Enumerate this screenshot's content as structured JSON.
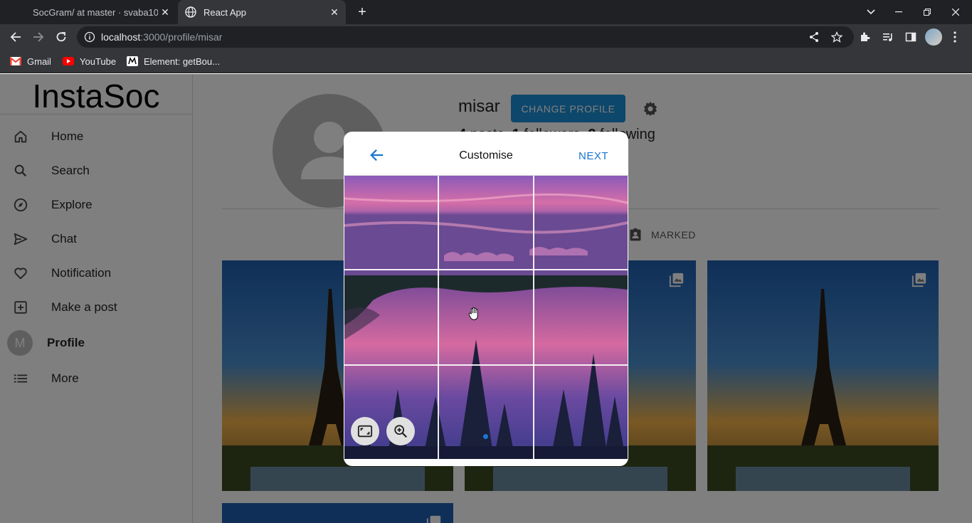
{
  "browser": {
    "tabs": [
      {
        "title": "SocGram/ at master · svaba10",
        "active": false
      },
      {
        "title": "React App",
        "active": true
      }
    ],
    "address": {
      "host": "localhost",
      "path": ":3000/profile/misar"
    },
    "bookmarks": [
      {
        "label": "Gmail",
        "icon": "gmail-icon"
      },
      {
        "label": "YouTube",
        "icon": "youtube-icon"
      },
      {
        "label": "Element: getBou...",
        "icon": "element-icon"
      }
    ]
  },
  "app": {
    "logo": "InstaSoc",
    "nav": [
      {
        "label": "Home",
        "icon": "home-icon"
      },
      {
        "label": "Search",
        "icon": "search-icon"
      },
      {
        "label": "Explore",
        "icon": "compass-icon"
      },
      {
        "label": "Chat",
        "icon": "send-icon"
      },
      {
        "label": "Notification",
        "icon": "heart-icon"
      },
      {
        "label": "Make a post",
        "icon": "add-box-icon"
      },
      {
        "label": "Profile",
        "avatar_letter": "M"
      },
      {
        "label": "More",
        "icon": "list-icon"
      }
    ]
  },
  "profile": {
    "username": "misar",
    "change_button": "CHANGE PROFILE",
    "stats": {
      "posts": "4",
      "posts_label": "posts",
      "followers": "1",
      "followers_label": "followers",
      "following": "2",
      "following_label": "following"
    },
    "marked_tab": "MARKED"
  },
  "modal": {
    "title": "Customise",
    "next": "NEXT"
  },
  "colors": {
    "accent": "#1976d2",
    "button": "#1a8fd6"
  }
}
